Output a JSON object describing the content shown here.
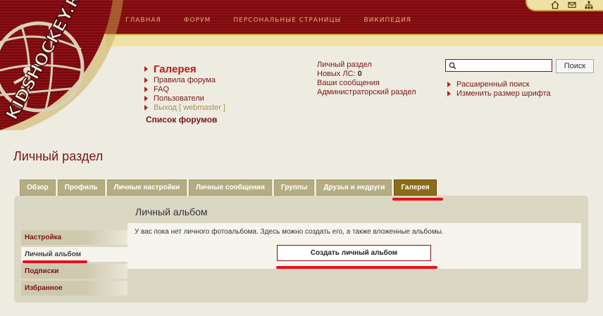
{
  "topnav": [
    "ГЛАВНАЯ",
    "ФОРУМ",
    "ПЕРСОНАЛЬНЫЕ СТРАНИЦЫ",
    "ВИКИПЕДИЯ"
  ],
  "logo_text": "KIDSHOCKEY.RU",
  "header_links": {
    "gallery": "Галерея",
    "rules": "Правила форума",
    "faq": "FAQ",
    "users": "Пользователи",
    "logout": "Выход [ webmaster ]",
    "forum_list": "Список форумов"
  },
  "user_links": {
    "personal": "Личный раздел",
    "new_pm_label": "Новых ЛС:",
    "new_pm_count": "0",
    "messages": "Ваши сообщения",
    "admin": "Администраторский раздел"
  },
  "search": {
    "button": "Поиск",
    "placeholder": ""
  },
  "right_links": {
    "advanced": "Расширенный поиск",
    "font": "Изменить размер шрифта"
  },
  "page_title": "Личный раздел",
  "tabs": [
    "Обзор",
    "Профиль",
    "Личные настройки",
    "Личные сообщения",
    "Группы",
    "Друзья и недруги",
    "Галерея"
  ],
  "panel_title": "Личный альбом",
  "side_menu": [
    "Настройка",
    "Личный альбом",
    "Подписки",
    "Избранное"
  ],
  "content_text": "У вас пока нет личного фотоальбома. Здесь можно создать его, а также вложенные альбомы.",
  "create_button": "Создать личный альбом",
  "colors": {
    "brand": "#8e1014",
    "gold": "#efe2a4",
    "active_tab": "#8b6d18",
    "marker": "#e8101b"
  }
}
